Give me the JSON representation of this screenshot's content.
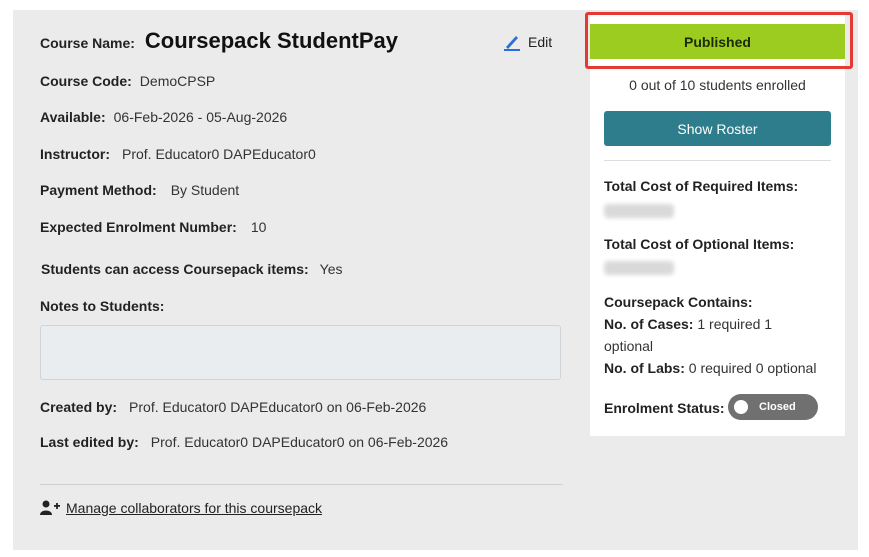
{
  "course": {
    "name_label": "Course Name:",
    "name": "Coursepack StudentPay",
    "edit_label": "Edit",
    "code_label": "Course Code:",
    "code": "DemoCPSP",
    "available_label": "Available:",
    "available": "06-Feb-2026 - 05-Aug-2026",
    "instructor_label": "Instructor:",
    "instructor": "Prof. Educator0 DAPEducator0",
    "payment_label": "Payment Method:",
    "payment": "By Student",
    "enrolment_label": "Expected Enrolment Number:",
    "enrolment": "10",
    "access_label": "Students can access Coursepack items:",
    "access": "Yes",
    "notes_label": "Notes to Students:",
    "notes": "",
    "created_label": "Created by:",
    "created": "Prof. Educator0 DAPEducator0 on 06-Feb-2026",
    "edited_label": "Last edited by:",
    "edited": "Prof. Educator0 DAPEducator0 on 06-Feb-2026",
    "collab_link": "Manage collaborators for this coursepack",
    "collab_icon": "add-user-icon"
  },
  "sidebar": {
    "status_button": "Published",
    "enrolled_text": "0 out of 10 students enrolled",
    "roster_button": "Show Roster",
    "required_cost_label": "Total Cost of Required Items:",
    "optional_cost_label": "Total Cost of Optional Items:",
    "contains_label": "Coursepack Contains:",
    "cases_label": "No. of Cases:",
    "cases_value": "1 required 1",
    "cases_value2": "optional",
    "labs_label": "No. of Labs:",
    "labs_value": "0 required 0 optional",
    "enrolment_status_label": "Enrolment Status:",
    "enrolment_status": "Closed"
  },
  "colors": {
    "published": "#9ccc1f",
    "roster": "#2e7d8c",
    "highlight": "#e53935",
    "toggle": "#707070"
  }
}
